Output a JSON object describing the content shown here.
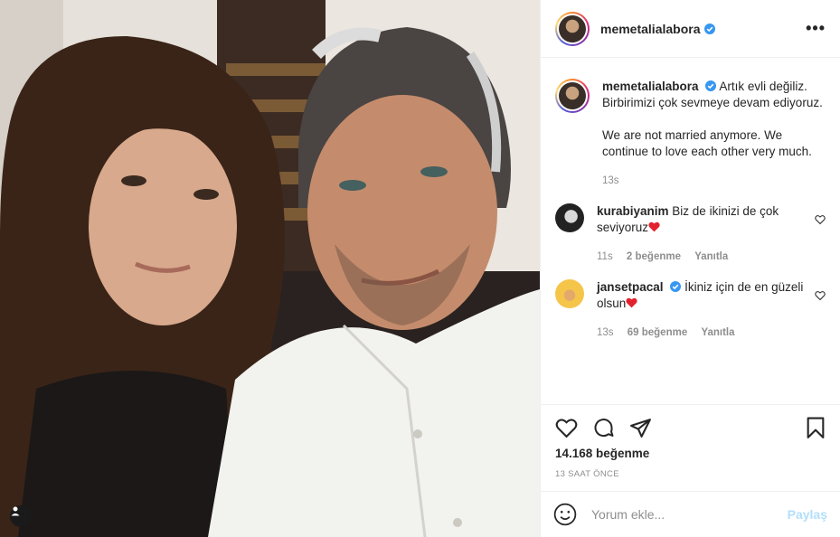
{
  "post": {
    "username": "memetalialabora",
    "caption_line1": "Artık evli değiliz. Birbirimizi çok sevmeye devam ediyoruz.",
    "caption_line2": "We are not married anymore. We continue to love each other very much.",
    "caption_time": "13s",
    "likes": "14.168 beğenme",
    "time_ago": "13 SAAT ÖNCE"
  },
  "comments": [
    {
      "username": "kurabiyanim",
      "text": "Biz de ikinizi de çok seviyoruz",
      "time": "11s",
      "likes": "2 beğenme",
      "reply": "Yanıtla"
    },
    {
      "username": "jansetpacal",
      "text": "İkiniz için de en güzeli olsun",
      "time": "13s",
      "likes": "69 beğenme",
      "reply": "Yanıtla"
    }
  ],
  "comment_input": {
    "placeholder": "Yorum ekle...",
    "post_label": "Paylaş"
  },
  "colors": {
    "verified": "#3897f0",
    "heart_red": "#ed4956",
    "post_button_disabled": "#b2dffc"
  },
  "icons": [
    "more-icon",
    "heart-icon",
    "comment-icon",
    "share-icon",
    "bookmark-icon",
    "emoji-icon",
    "user-tag-icon",
    "verified-icon"
  ]
}
